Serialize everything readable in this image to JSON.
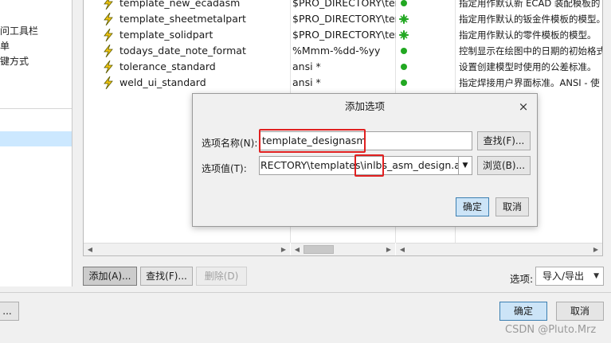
{
  "left_nav": {
    "items": [
      {
        "label": "问工具栏"
      },
      {
        "label": "单"
      },
      {
        "label": "键方式"
      }
    ],
    "selected_index": 3
  },
  "options_list": {
    "rows": [
      {
        "name": "template_new_ecadasm",
        "value": "$PRO_DIRECTORY\\ter",
        "status": "dot",
        "desc": "指定用作默认新 ECAD 装配模板的"
      },
      {
        "name": "template_sheetmetalpart",
        "value": "$PRO_DIRECTORY\\ter",
        "status": "star",
        "desc": "指定用作默认的钣金件模板的模型。"
      },
      {
        "name": "template_solidpart",
        "value": "$PRO_DIRECTORY\\ter",
        "status": "star",
        "desc": "指定用作默认的零件模板的模型。"
      },
      {
        "name": "todays_date_note_format",
        "value": "%Mmm-%dd-%yy",
        "status": "dot",
        "desc": "控制显示在绘图中的日期的初始格式"
      },
      {
        "name": "tolerance_standard",
        "value": "ansi *",
        "status": "dot",
        "desc": "设置创建模型时使用的公差标准。"
      },
      {
        "name": "weld_ui_standard",
        "value": "ansi *",
        "status": "dot",
        "desc": "指定焊接用户界面标准。ANSI - 使"
      }
    ]
  },
  "main_buttons": {
    "add": "添加(A)...",
    "find": "查找(F)...",
    "delete": "删除(D)"
  },
  "options_select": {
    "label": "选项:",
    "value": "导入/导出"
  },
  "footer": {
    "left_partial": "...",
    "ok": "确定",
    "cancel": "取消"
  },
  "dialog": {
    "title": "添加选项",
    "close": "×",
    "name_label": "选项名称(N):",
    "name_value": "template_designasm",
    "find_button": "查找(F)...",
    "value_label": "选项值(T):",
    "value_value": "RECTORY\\templates\\inlbs_asm_design.asm",
    "browse_button": "浏览(B)...",
    "ok": "确定",
    "cancel": "取消"
  },
  "watermark": "CSDN @Pluto.Mrz",
  "colors": {
    "accent_blue": "#cce4f7",
    "highlight_red": "#e02020",
    "status_green": "#22a822",
    "selection": "#cce8ff"
  }
}
